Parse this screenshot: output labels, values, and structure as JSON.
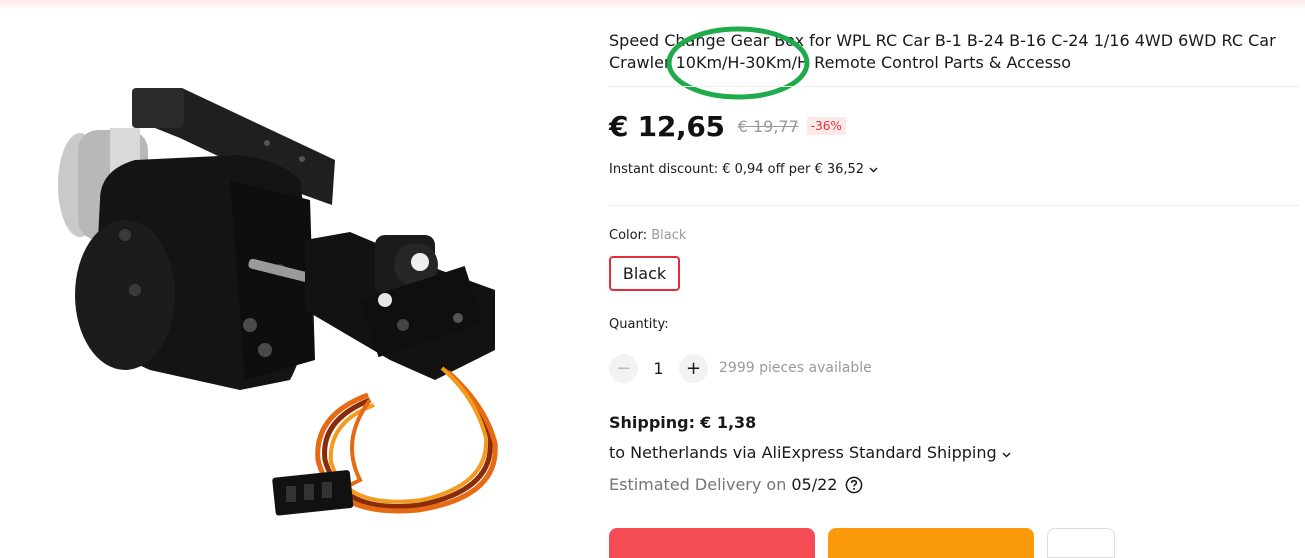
{
  "product": {
    "title_line1": "Speed Change Gear Box for WPL RC Car B-1 B-24 B-16 C-24 1/16 4WD 6WD RC Car",
    "title_line2": "Crawler 10Km/H-30Km/H Remote Control Parts & Accesso",
    "image_alt": "black gearbox with servo and orange wires"
  },
  "price": {
    "current": "€ 12,65",
    "original": "€ 19,77",
    "discount": "-36%"
  },
  "instant_discount": {
    "text": "Instant discount: € 0,94 off per € 36,52"
  },
  "color": {
    "label": "Color: ",
    "selected": "Black",
    "options": [
      "Black"
    ]
  },
  "quantity": {
    "label": "Quantity:",
    "value": "1",
    "minus": "−",
    "plus": "+",
    "available": "2999 pieces available"
  },
  "shipping": {
    "label": "Shipping:",
    "price": "€ 1,38",
    "destination": "to Netherlands via AliExpress Standard Shipping",
    "delivery_label": "Estimated Delivery on",
    "delivery_date": "05/22"
  },
  "colors": {
    "accent": "#e62e3a",
    "buy_button": "#f54b55",
    "cart_button": "#fb9b0c",
    "annotation": "#1faa4b"
  },
  "icons": [
    "chevron-down-icon",
    "help-circle-icon"
  ]
}
